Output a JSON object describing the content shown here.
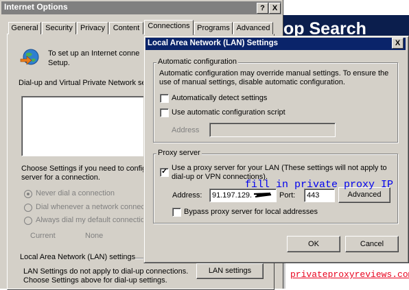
{
  "background_page": {
    "banner_text": "op Search",
    "link_text": "privateproxyreviews.com"
  },
  "internet_options": {
    "title": "Internet Options",
    "help_btn": "?",
    "close_btn": "X",
    "tabs": [
      "General",
      "Security",
      "Privacy",
      "Content",
      "Connections",
      "Programs",
      "Advanced"
    ],
    "selected_tab": "Connections",
    "intro_text_1": "To set up an Internet conne",
    "intro_text_2": "Setup.",
    "dialup_label": "Dial-up and Virtual Private Network se",
    "choose_settings_1": "Choose Settings if you need to config",
    "choose_settings_2": "server for a connection.",
    "radio_never": "Never dial a connection",
    "radio_whenever": "Dial whenever a network connec",
    "radio_always": "Always dial my default connectio",
    "current_label": "Current",
    "current_value": "None",
    "lan_section_label": "Local Area Network (LAN) settings",
    "lan_text_1": "LAN Settings do not apply to dial-up connections.",
    "lan_text_2": "Choose Settings above for dial-up settings.",
    "lan_settings_button": "LAN settings"
  },
  "lan_dialog": {
    "title": "Local Area Network (LAN) Settings",
    "close_btn": "X",
    "auto_config": {
      "group_label": "Automatic configuration",
      "desc_1": "Automatic configuration may override manual settings.  To ensure the",
      "desc_2": "use of manual settings, disable automatic configuration.",
      "auto_detect_label": "Automatically detect settings",
      "auto_detect_checked": false,
      "auto_script_label": "Use automatic configuration script",
      "auto_script_checked": false,
      "address_label": "Address",
      "address_value": ""
    },
    "proxy": {
      "group_label": "Proxy server",
      "use_proxy_label_1": "Use a proxy server for your LAN (These settings will not apply to",
      "use_proxy_label_2": "dial-up or VPN connections).",
      "use_proxy_checked": true,
      "check_mark": "✓",
      "address_label": "Address:",
      "address_value": "91.197.129.",
      "port_label": "Port:",
      "port_value": "443",
      "advanced_button": "Advanced",
      "bypass_label": "Bypass proxy server for local addresses",
      "bypass_checked": false
    },
    "ok_button": "OK",
    "cancel_button": "Cancel"
  },
  "annotation": "fill in private proxy IP",
  "colors": {
    "dialog_face": "#d4d0c8",
    "active_title": "#0a246a",
    "inactive_title": "#808080",
    "annotation": "#0000ee",
    "link": "#e8001c",
    "banner": "#0b1e4d"
  }
}
